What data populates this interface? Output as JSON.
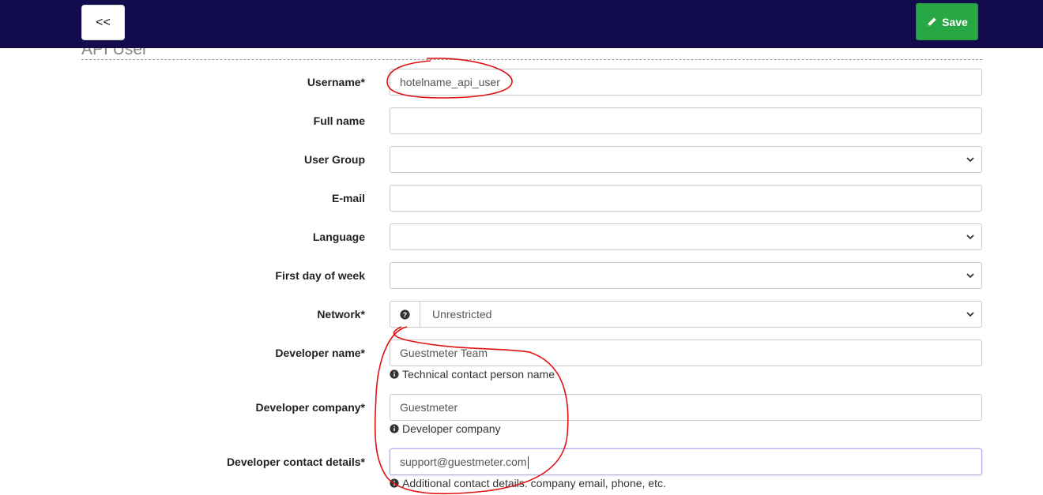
{
  "header": {
    "back_label": "<<",
    "save_label": "Save"
  },
  "section": {
    "title": "API User"
  },
  "form": {
    "username": {
      "label": "Username*",
      "value": "hotelname_api_user"
    },
    "full_name": {
      "label": "Full name",
      "value": ""
    },
    "user_group": {
      "label": "User Group",
      "value": ""
    },
    "email": {
      "label": "E-mail",
      "value": ""
    },
    "language": {
      "label": "Language",
      "value": ""
    },
    "first_day": {
      "label": "First day of week",
      "value": ""
    },
    "network": {
      "label": "Network*",
      "value": "Unrestricted",
      "help_icon": "question-circle-icon"
    },
    "developer_name": {
      "label": "Developer name*",
      "value": "Guestmeter Team",
      "hint": "Technical contact person name"
    },
    "developer_company": {
      "label": "Developer company*",
      "value": "Guestmeter",
      "hint": "Developer company"
    },
    "developer_contact": {
      "label": "Developer contact details*",
      "value": "support@guestmeter.com",
      "hint": "Additional contact details: company email, phone, etc."
    }
  },
  "colors": {
    "topbar": "#120b4c",
    "save_button": "#27a844",
    "annotation": "#e01010"
  }
}
